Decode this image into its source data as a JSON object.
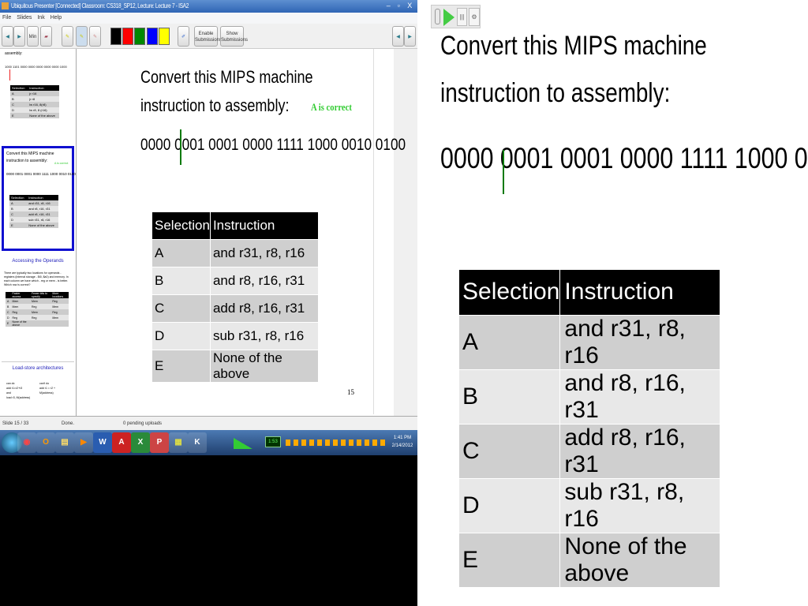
{
  "window": {
    "title": "Ubiquitous Presenter [Connected] Classroom: CS318_SP12, Lecture: Lecture 7 - ISA2",
    "min": "–",
    "max": "▫",
    "close": "X"
  },
  "menu": [
    "File",
    "Slides",
    "Ink",
    "Help"
  ],
  "toolbar": {
    "min_label": "Min",
    "enable_label": "Enable Submissions",
    "show_label": "Show Submissions",
    "colors": [
      "#000000",
      "#ff0000",
      "#008000",
      "#0000ff",
      "#ffff00"
    ]
  },
  "slide": {
    "title": "Convert this MIPS machine instruction to assembly:",
    "annotation": "A is correct",
    "annotation_color": "#33cc33",
    "binary": "0000 0001 0001 0000 1111 1000 0010 0100",
    "headers": [
      "Selection",
      "Instruction"
    ],
    "rows": [
      [
        "A",
        "and  r31, r8, r16"
      ],
      [
        "B",
        "and r8, r16, r31"
      ],
      [
        "C",
        "add r8, r16, r31"
      ],
      [
        "D",
        "sub r31, r8, r16"
      ],
      [
        "E",
        "None of the above"
      ]
    ],
    "number": "15"
  },
  "thumbs": {
    "prev": {
      "title": "assembly:",
      "binary": "1000 1101 0000 0000 0000 0000 0000 1000",
      "headers": [
        "Selection",
        "Instruction"
      ],
      "rows": [
        [
          "A",
          "jr r16"
        ],
        [
          "B",
          "jr r8"
        ],
        [
          "C",
          "lw r16, 8(r8)"
        ],
        [
          "D",
          "lw r8, 8 (r16)"
        ],
        [
          "E",
          "None of the above"
        ]
      ]
    },
    "current": {
      "title": "Convert this MIPS machine instruction to assembly:",
      "annotation": "A is correct",
      "binary": "0000 0001 0001 0000 1111 1000 0010 0100",
      "headers": [
        "Selection",
        "Instruction"
      ],
      "rows": [
        [
          "A",
          "and r31, r8, r16"
        ],
        [
          "B",
          "and r8, r16, r31"
        ],
        [
          "C",
          "add r8, r16, r31"
        ],
        [
          "D",
          "sub r31, r8, r16"
        ],
        [
          "E",
          "None of the above"
        ]
      ]
    },
    "next": {
      "title": "Accessing the Operands",
      "text": "There are typically two locations for operands - registers (internal storage - $t0, $a0) and memory. In each column we have which - reg or mem - is better. Which row is correct?",
      "headers": [
        "",
        "Faster access",
        "Fewer bits to specify",
        "More locations"
      ],
      "rows": [
        [
          "A",
          "Mem",
          "Mem",
          "Reg"
        ],
        [
          "B",
          "Mem",
          "Reg",
          "Mem"
        ],
        [
          "C",
          "Reg",
          "Mem",
          "Reg"
        ],
        [
          "D",
          "Reg",
          "Reg",
          "Mem"
        ],
        [
          "E",
          "None of the above",
          "",
          ""
        ]
      ]
    },
    "next2": {
      "title": "Load-store architectures",
      "left": [
        "can do",
        "add r1=r2+r3",
        "and",
        "load r3, M(address)"
      ],
      "right": [
        "can't do",
        "add r1 = r2 +",
        "M(address)"
      ]
    }
  },
  "status": {
    "slide": "Slide 15 / 33",
    "state": "Done.",
    "uploads": "0 pending uploads"
  },
  "taskbar": {
    "apps": [
      "◉",
      "O",
      "▤",
      "▶",
      "W",
      "A",
      "X",
      "P",
      "▦",
      "K"
    ],
    "battery": "1:53",
    "time": "1:41 PM",
    "date": "2/14/2012"
  }
}
